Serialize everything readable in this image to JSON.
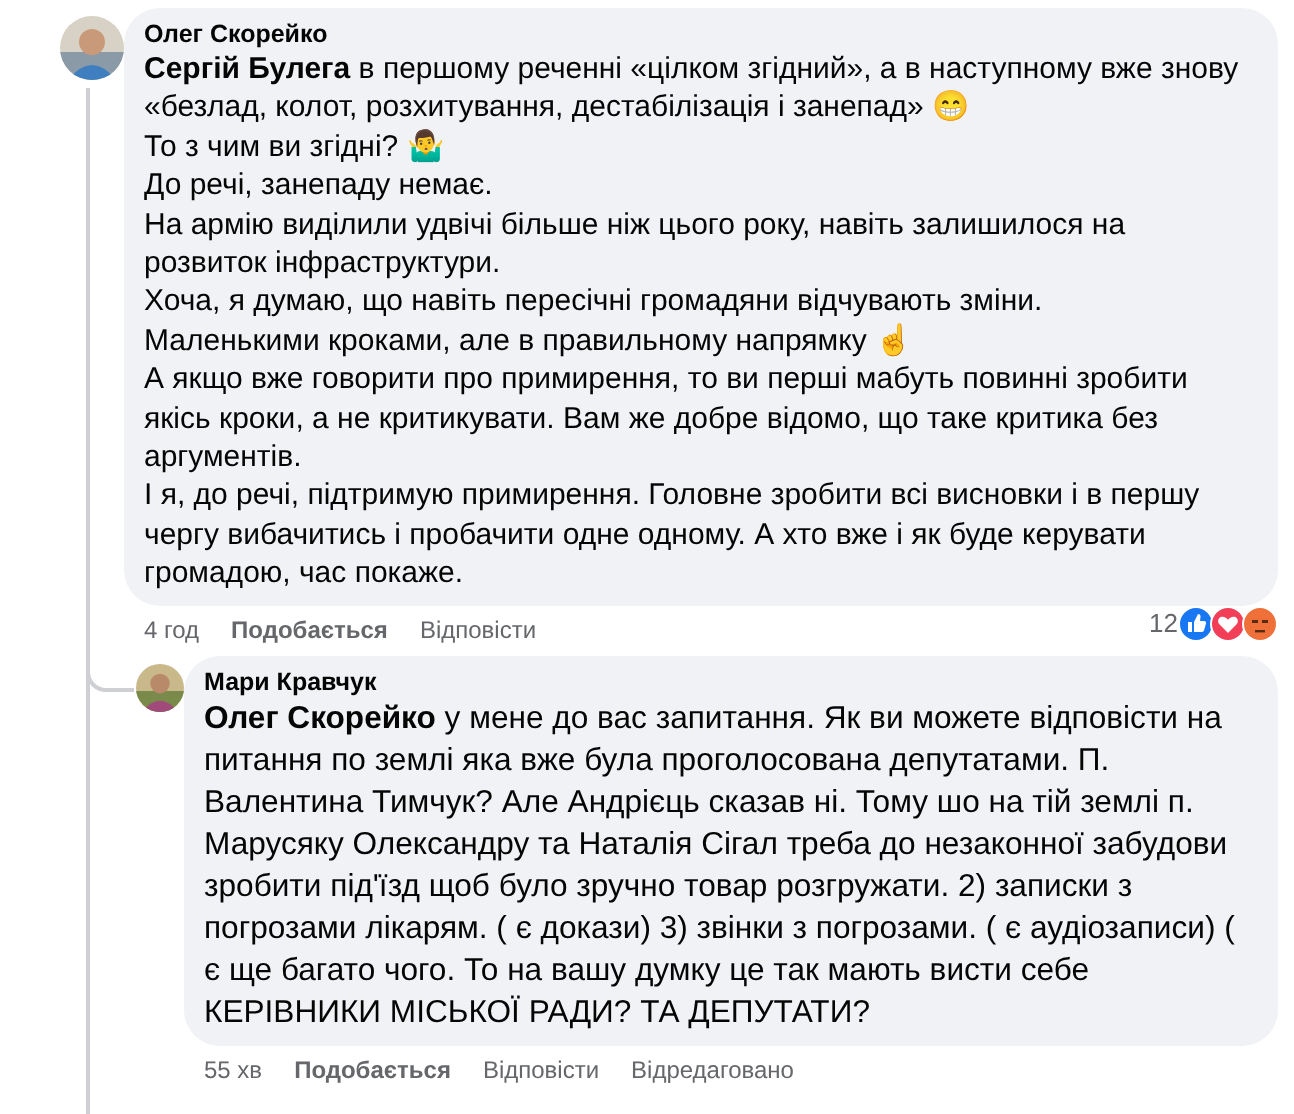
{
  "comments": [
    {
      "author": "Олег Скорейко",
      "avatar": {
        "kind": "picture"
      },
      "paragraphs": [
        "**Сергій Булега** в першому реченні «цілком згідний», а в наступному вже знову «безлад, колот, розхитування, дестабілізація і занепад» 😁",
        "То з чим ви згідні? 🤷‍♂️",
        "До речі, занепаду немає.",
        "На армію виділили удвічі більше ніж цього року, навіть залишилося на розвиток інфраструктури.",
        "Хоча, я думаю, що навіть пересічні громадяни відчувають зміни.",
        "Маленькими кроками, але в правильному напрямку ☝️",
        "А якщо вже говорити про примирення, то ви перші мабуть повинні зробити якісь кроки, а не критикувати. Вам же добре відомо, що таке критика без аргументів.",
        "І я, до речі, підтримую примирення. Головне зробити всі висновки і в першу чергу вибачитись і пробачити одне одному. А хто вже і як буде керувати громадою, час покаже."
      ],
      "actions": [
        {
          "kind": "time",
          "label": "4 год"
        },
        {
          "kind": "like",
          "label": "Подобається"
        },
        {
          "kind": "reply",
          "label": "Відповісти"
        }
      ],
      "reaction_count": "12",
      "reactions": [
        {
          "kind": "like"
        },
        {
          "kind": "love"
        },
        {
          "kind": "angry"
        }
      ]
    },
    {
      "author": "Мари Кравчук",
      "avatar": {
        "kind": "picture"
      },
      "paragraphs": [
        "**Олег Скорейко** у мене до вас запитання. Як ви можете відповісти на питання по землі яка вже була проголосована депутатами. П. Валентина Тимчук? Але Андрієць сказав ні. Тому шо на тій землі п. Марусяку Олександру та Наталія Сігал треба до незаконної забудови зробити під'їзд щоб було зручно товар розгружати. 2) записки з погрозами лікарям. ( є докази) 3) звінки з погрозами. ( є аудіозаписи) ( є ще багато чого. То на вашу думку це так мають висти себе КЕРІВНИКИ МІСЬКОЇ РАДИ? ТА ДЕПУТАТИ?"
      ],
      "actions": [
        {
          "kind": "time",
          "label": "55 хв"
        },
        {
          "kind": "like",
          "label": "Подобається"
        },
        {
          "kind": "reply",
          "label": "Відповісти"
        },
        {
          "kind": "edited",
          "label": "Відредаговано"
        }
      ]
    }
  ]
}
